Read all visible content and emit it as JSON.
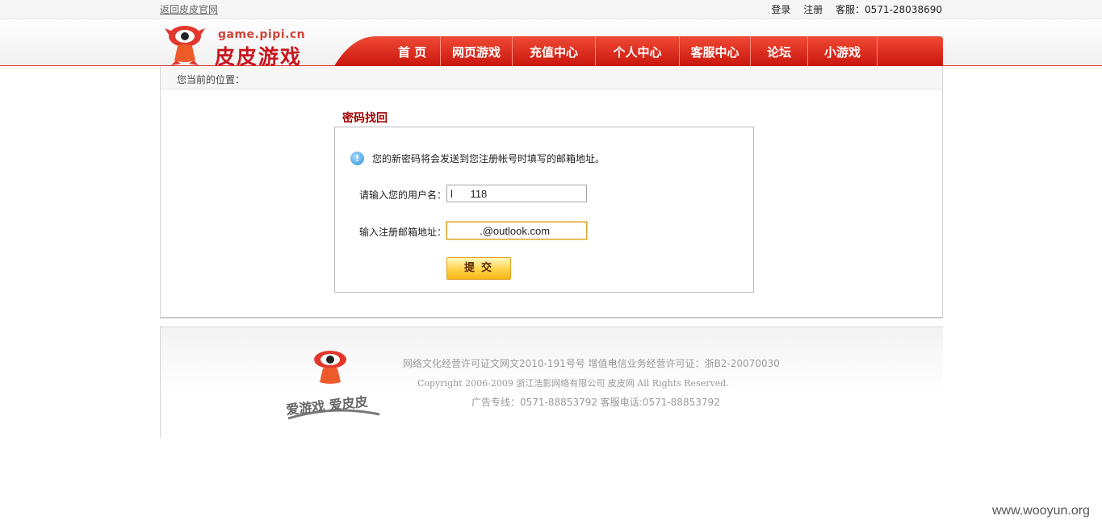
{
  "topbar": {
    "back_link": "返回皮皮官网",
    "login": "登录",
    "register": "注册",
    "service_phone": "客服：0571-28038690"
  },
  "header": {
    "domain": "game.pipi.cn",
    "brand": "皮皮游戏",
    "nav": [
      "首 页",
      "网页游戏",
      "充值中心",
      "个人中心",
      "客服中心",
      "论坛",
      "小游戏"
    ]
  },
  "breadcrumb": {
    "label": "您当前的位置："
  },
  "recover": {
    "title": "密码找回",
    "notice": "您的新密码将会发送到您注册帐号时填写的邮箱地址。",
    "username_label": "请输入您的用户名：",
    "username_value": "l      118",
    "email_label": "输入注册邮箱地址：",
    "email_value": "          .@outlook.com",
    "submit_label": "提交"
  },
  "footer": {
    "logo_text": "爱游戏 爱皮皮",
    "line1": "网络文化经营许可证文网文2010-191号号  增值电信业务经营许可证：浙B2-20070030",
    "line2": "Copyright 2006-2009 浙江浩影网络有限公司 皮皮网 All Rights Reserved.",
    "line3": "广告专线：0571-88853792 客服电话:0571-88853792"
  },
  "watermark": "www.wooyun.org",
  "colors": {
    "brand_red": "#c8161d",
    "nav_red": "#d7281b",
    "title_red": "#a30000",
    "button_yellow": "#ffd34a"
  }
}
